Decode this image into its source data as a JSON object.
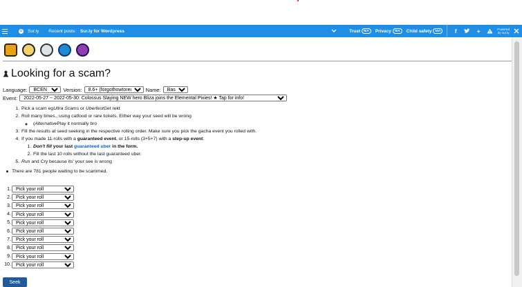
{
  "topbar": {
    "site": "Sur.ly",
    "recent_label": "Recent posts:",
    "recent_post": "Sur.ly for Wordpress",
    "links": [
      {
        "label": "Trust",
        "badge": "N/A"
      },
      {
        "label": "Privacy",
        "badge": "N/A"
      },
      {
        "label": "Child safety",
        "badge": "N/A"
      }
    ],
    "powered_line1": "Powered",
    "powered_line2": "by sur.ly"
  },
  "page": {
    "title": "Looking for a scam?",
    "language_label": "Language:",
    "language_value": "BCEN",
    "version_label": "Version:",
    "version_value": "8.6+ (forgothowtoreddit)",
    "name_label": "Name:",
    "name_value": "Base",
    "event_label": "Event:",
    "event_value": "2022-05-27 ~ 2022-05-30: Colossus Slaying NEW hero Bliza joins the Elemental Pixies! ★ Tap for info!"
  },
  "instructions": {
    "s1_a": "Pick a scam eg",
    "s1_b": "Ultra Scams",
    "s1_c": " or ",
    "s1_d": "Uberfest",
    "s1_e": "Get rekt",
    "s2": "Roll many times., using catfood or rare tickets. Either way your seed will be wrong",
    "s2_sub_a": "(",
    "s2_sub_b": "Alternative",
    "s2_sub_c": "Play it normally bro",
    "s3": "Fill the results at seed seeking in the respective rolling order. Make sure you pick the gacha event you rolled with.",
    "s4_a": "If you made 11-rolls with a ",
    "s4_b": "guaranteed event",
    "s4_c": ", or 15-rolls (3+5+7) with a ",
    "s4_d": "step-up event",
    "s4_e": ":",
    "s4_sub1_a": "Don't fill",
    "s4_sub1_b": " your last ",
    "s4_sub1_c": "guaranteed uber",
    "s4_sub1_d": " in the form.",
    "s4_sub2": "Fill the last 10 rolls without the last guaranteed uber.",
    "s5_a": "Run",
    "s5_b": " and Cry because its' your see is wrong"
  },
  "people_text": "There are 781 people waiting to be scammed.",
  "rolls": [
    {
      "num": "1.",
      "placeholder": "Pick your roll"
    },
    {
      "num": "2.",
      "placeholder": "Pick your roll"
    },
    {
      "num": "3.",
      "placeholder": "Pick your roll"
    },
    {
      "num": "4.",
      "placeholder": "Pick your roll"
    },
    {
      "num": "5.",
      "placeholder": "Pick your roll"
    },
    {
      "num": "6.",
      "placeholder": "Pick your roll"
    },
    {
      "num": "7.",
      "placeholder": "Pick your roll"
    },
    {
      "num": "8.",
      "placeholder": "Pick your roll"
    },
    {
      "num": "9.",
      "placeholder": "Pick your roll"
    },
    {
      "num": "10.",
      "placeholder": "Pick your roll"
    }
  ],
  "seek_label": "Seek",
  "colors": {
    "topbar": "#1f8ee6",
    "seek": "#215a99",
    "link": "#1a5fa8"
  }
}
